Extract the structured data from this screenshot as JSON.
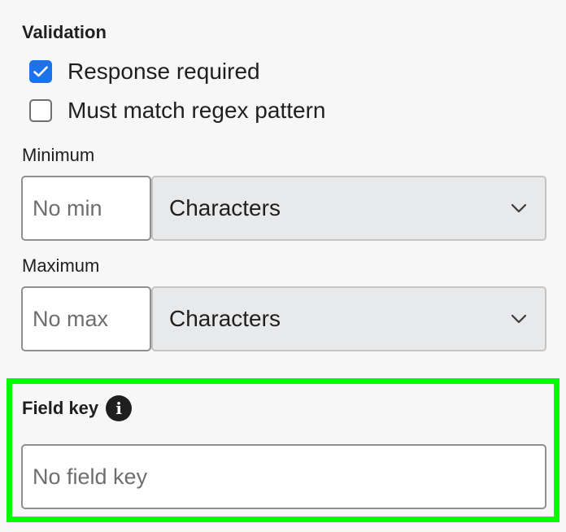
{
  "validation": {
    "title": "Validation",
    "options": [
      {
        "label": "Response required",
        "checked": true
      },
      {
        "label": "Must match regex pattern",
        "checked": false
      }
    ],
    "minimum": {
      "label": "Minimum",
      "placeholder": "No min",
      "unit": "Characters"
    },
    "maximum": {
      "label": "Maximum",
      "placeholder": "No max",
      "unit": "Characters"
    }
  },
  "field_key": {
    "title": "Field key",
    "info_icon": "info-icon",
    "placeholder": "No field key"
  },
  "colors": {
    "accent": "#1a73e8",
    "highlight": "#00ff00",
    "background": "#f7f7f7"
  }
}
